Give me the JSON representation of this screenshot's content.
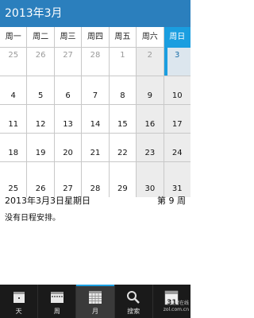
{
  "header": {
    "title": "2013年3月"
  },
  "weekdays": [
    "周一",
    "周二",
    "周三",
    "周四",
    "周五",
    "周六",
    "周日"
  ],
  "weeks": [
    [
      "25",
      "26",
      "27",
      "28",
      "1",
      "2",
      "3"
    ],
    [
      "4",
      "5",
      "6",
      "7",
      "8",
      "9",
      "10"
    ],
    [
      "11",
      "12",
      "13",
      "14",
      "15",
      "16",
      "17"
    ],
    [
      "18",
      "19",
      "20",
      "21",
      "22",
      "23",
      "24"
    ],
    [
      "25",
      "26",
      "27",
      "28",
      "29",
      "30",
      "31"
    ]
  ],
  "detail": {
    "date": "2013年3月3日星期日",
    "week": "第 9 周",
    "empty_text": "没有日程安排。"
  },
  "tabs": [
    {
      "label": "天",
      "icon": "day-view-icon"
    },
    {
      "label": "周",
      "icon": "week-view-icon"
    },
    {
      "label": "月",
      "icon": "month-view-icon",
      "active": true
    },
    {
      "label": "搜索",
      "icon": "search-icon"
    },
    {
      "label": "",
      "icon": "today-calendar-icon",
      "badge": "31"
    }
  ],
  "watermark": {
    "line1": "中关村在线",
    "line2": "zol.com.cn"
  },
  "colors": {
    "accent": "#1a9ee0",
    "title_bar": "#2b7fbd",
    "tabbar": "#1a1a1a"
  }
}
